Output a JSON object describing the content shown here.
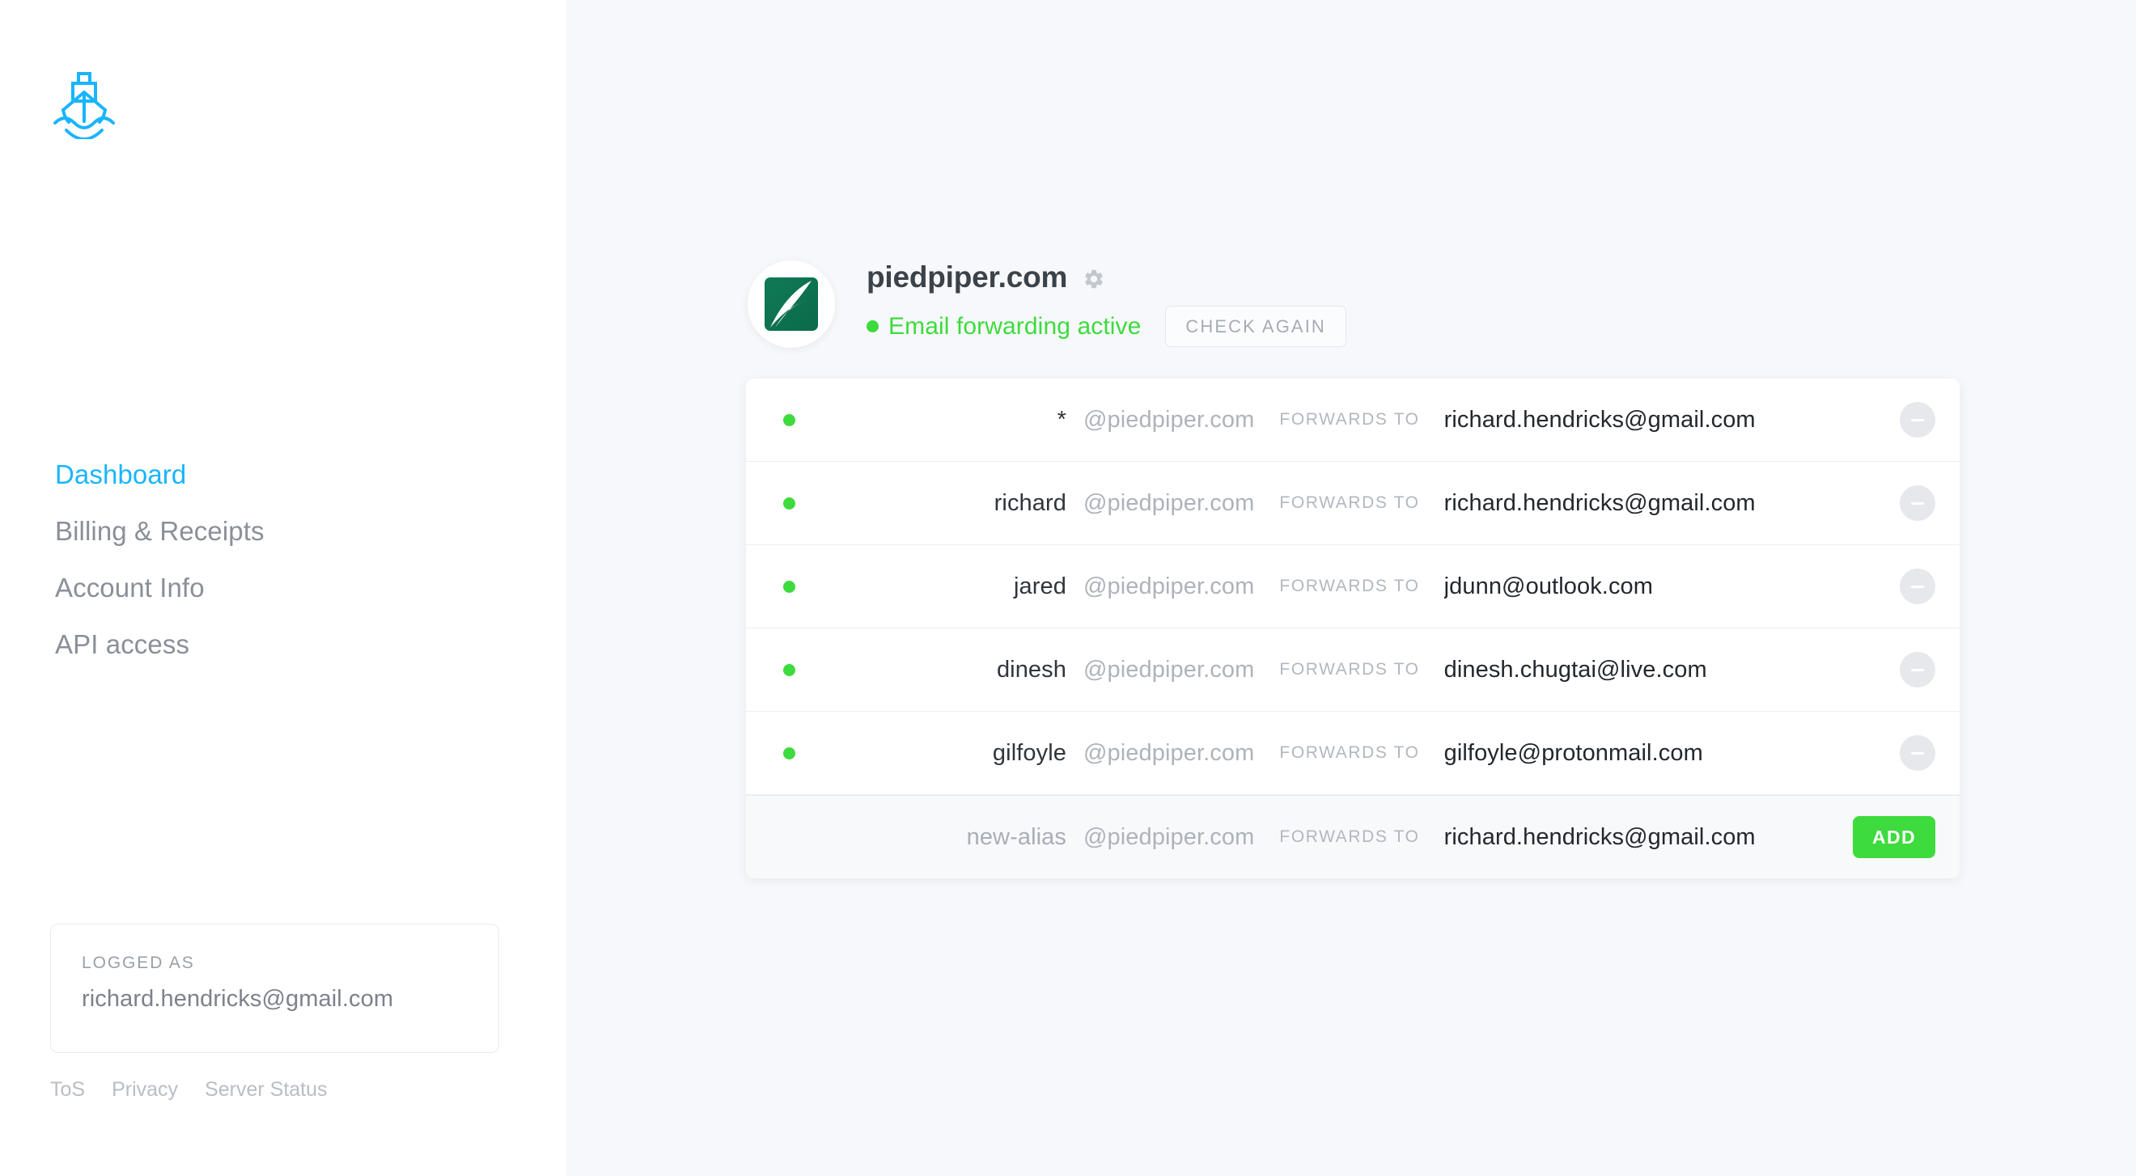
{
  "sidebar": {
    "logo_icon": "ship-icon",
    "nav_items": [
      {
        "label": "Dashboard",
        "active": true
      },
      {
        "label": "Billing & Receipts",
        "active": false
      },
      {
        "label": "Account Info",
        "active": false
      },
      {
        "label": "API access",
        "active": false
      }
    ],
    "logged_as": {
      "label": "LOGGED AS",
      "email": "richard.hendricks@gmail.com"
    },
    "footer_links": [
      "ToS",
      "Privacy",
      "Server Status"
    ]
  },
  "header": {
    "avatar_icon": "piedpiper-logo-icon",
    "domain": "piedpiper.com",
    "settings_icon": "gear-icon",
    "status_text": "Email forwarding active",
    "status_color": "#3ddb3d",
    "check_again_label": "CHECK AGAIN"
  },
  "table": {
    "forwards_label": "FORWARDS TO",
    "domain_suffix": "@piedpiper.com",
    "remove_icon": "minus-circle-icon",
    "add_label": "ADD",
    "rows": [
      {
        "alias": "*",
        "target": "richard.hendricks@gmail.com",
        "active": true
      },
      {
        "alias": "richard",
        "target": "richard.hendricks@gmail.com",
        "active": true
      },
      {
        "alias": "jared",
        "target": "jdunn@outlook.com",
        "active": true
      },
      {
        "alias": "dinesh",
        "target": "dinesh.chugtai@live.com",
        "active": true
      },
      {
        "alias": "gilfoyle",
        "target": "gilfoyle@protonmail.com",
        "active": true
      }
    ],
    "new_row": {
      "alias_placeholder": "new-alias",
      "target_placeholder": "richard.hendricks@gmail.com"
    }
  },
  "colors": {
    "accent_blue": "#19b5fe",
    "status_green": "#3ddb3d",
    "sidebar_bg": "#ffffff",
    "main_bg": "#f7f8fb"
  }
}
